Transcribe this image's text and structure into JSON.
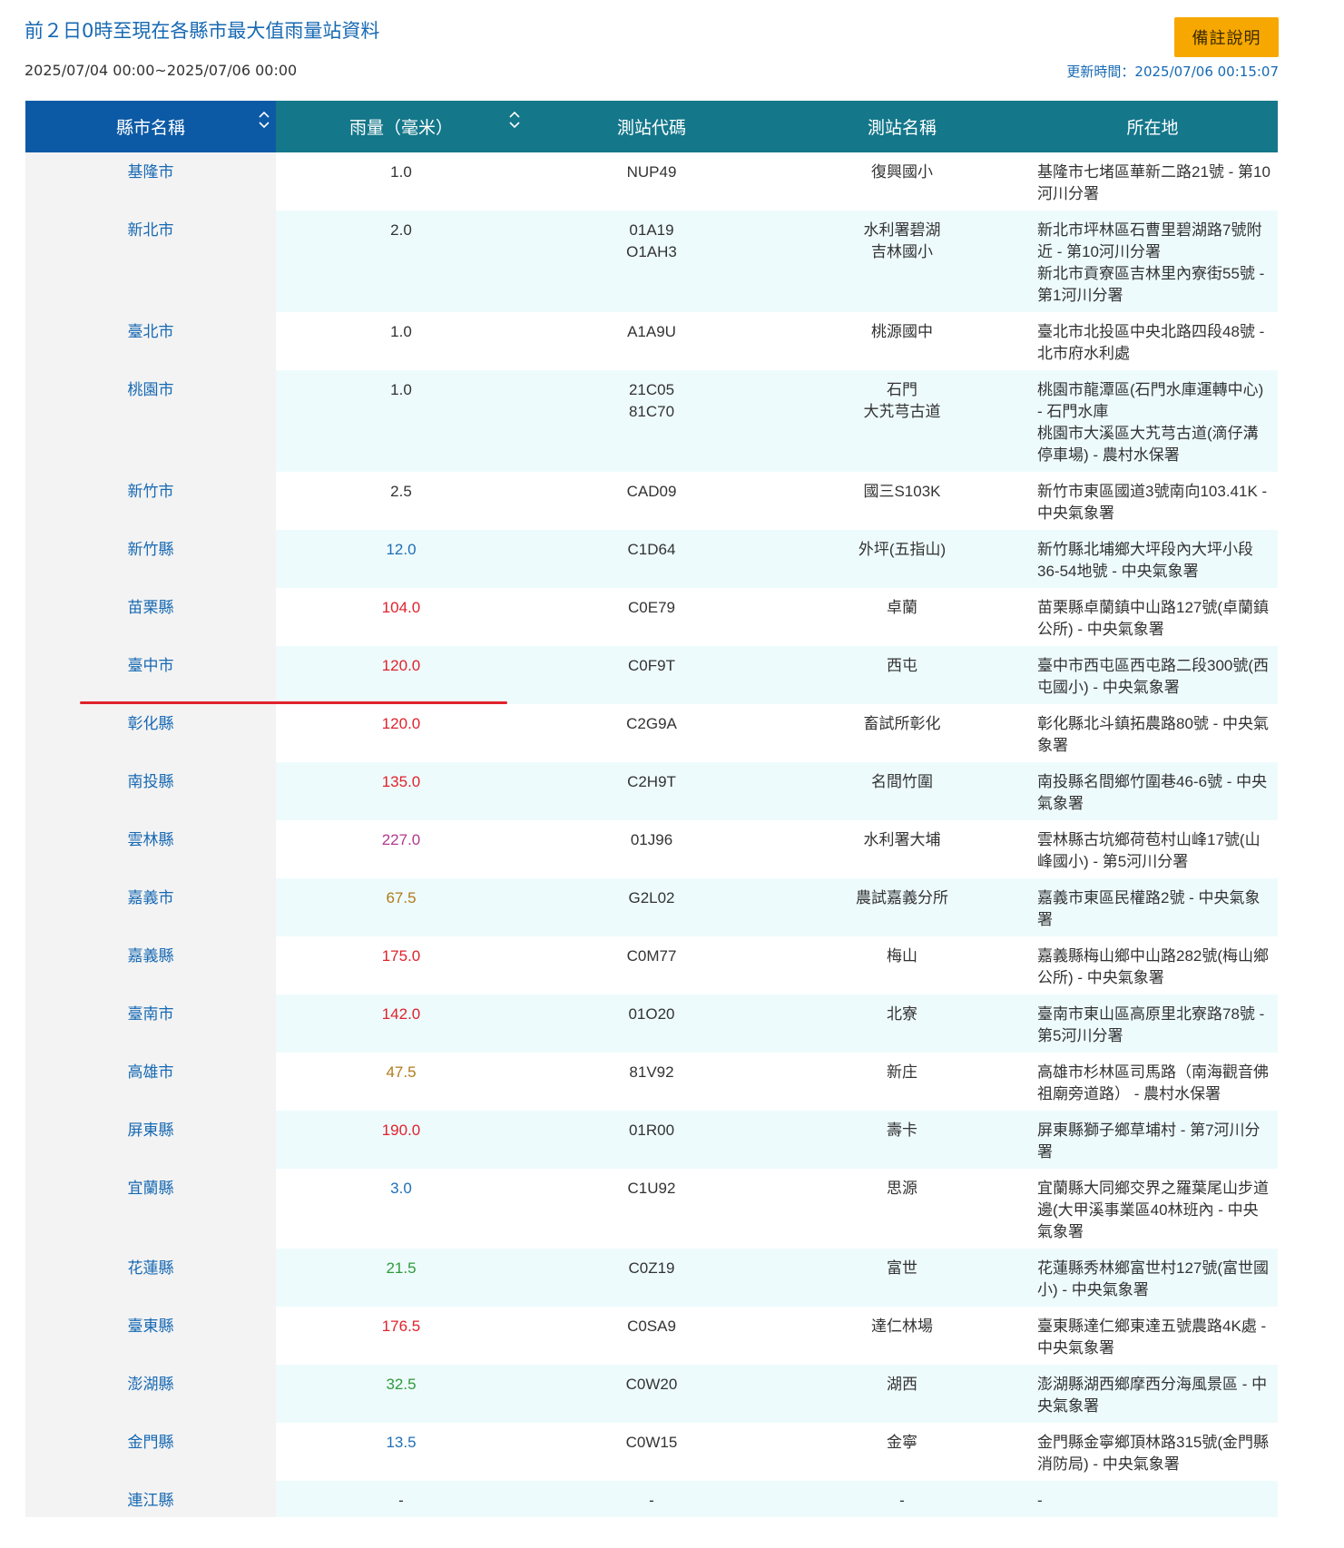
{
  "header": {
    "title": "前２日0時至現在各縣市最大值雨量站資料",
    "date_range": "2025/07/04 00:00~2025/07/06 00:00",
    "notes_button": "備註說明",
    "update_time": "更新時間：2025/07/06 00:15:07"
  },
  "table": {
    "columns": [
      "縣市名稱",
      "雨量（毫米）",
      "測站代碼",
      "測站名稱",
      "所在地"
    ],
    "rows": [
      {
        "county": "基隆市",
        "rain": "1.0",
        "rain_color": "#333333",
        "codes": [
          "NUP49"
        ],
        "names": [
          "復興國小"
        ],
        "locations": [
          "基隆市七堵區華新二路21號 - 第10河川分署"
        ]
      },
      {
        "county": "新北市",
        "rain": "2.0",
        "rain_color": "#333333",
        "codes": [
          "01A19",
          "O1AH3"
        ],
        "names": [
          "水利署碧湖",
          "吉林國小"
        ],
        "locations": [
          "新北市坪林區石曹里碧湖路7號附近 - 第10河川分署",
          "新北市貢寮區吉林里內寮街55號 - 第1河川分署"
        ]
      },
      {
        "county": "臺北市",
        "rain": "1.0",
        "rain_color": "#333333",
        "codes": [
          "A1A9U"
        ],
        "names": [
          "桃源國中"
        ],
        "locations": [
          "臺北市北投區中央北路四段48號 - 北市府水利處"
        ]
      },
      {
        "county": "桃園市",
        "rain": "1.0",
        "rain_color": "#333333",
        "codes": [
          "21C05",
          "81C70"
        ],
        "names": [
          "石門",
          "大艽芎古道"
        ],
        "locations": [
          "桃園市龍潭區(石門水庫運轉中心) - 石門水庫",
          "桃園市大溪區大艽芎古道(滴仔溝停車場) - 農村水保署"
        ]
      },
      {
        "county": "新竹市",
        "rain": "2.5",
        "rain_color": "#333333",
        "codes": [
          "CAD09"
        ],
        "names": [
          "國三S103K"
        ],
        "locations": [
          "新竹市東區國道3號南向103.41K - 中央氣象署"
        ]
      },
      {
        "county": "新竹縣",
        "rain": "12.0",
        "rain_color": "#1f6fb5",
        "codes": [
          "C1D64"
        ],
        "names": [
          "外坪(五指山)"
        ],
        "locations": [
          "新竹縣北埔鄉大坪段內大坪小段36-54地號 - 中央氣象署"
        ]
      },
      {
        "county": "苗栗縣",
        "rain": "104.0",
        "rain_color": "#e0222b",
        "codes": [
          "C0E79"
        ],
        "names": [
          "卓蘭"
        ],
        "locations": [
          "苗栗縣卓蘭鎮中山路127號(卓蘭鎮公所) - 中央氣象署"
        ]
      },
      {
        "county": "臺中市",
        "rain": "120.0",
        "rain_color": "#e0222b",
        "codes": [
          "C0F9T"
        ],
        "names": [
          "西屯"
        ],
        "locations": [
          "臺中市西屯區西屯路二段300號(西屯國小) - 中央氣象署"
        ]
      },
      {
        "county": "彰化縣",
        "rain": "120.0",
        "rain_color": "#e0222b",
        "codes": [
          "C2G9A"
        ],
        "names": [
          "畜試所彰化"
        ],
        "locations": [
          "彰化縣北斗鎮拓農路80號 - 中央氣象署"
        ]
      },
      {
        "county": "南投縣",
        "rain": "135.0",
        "rain_color": "#e0222b",
        "codes": [
          "C2H9T"
        ],
        "names": [
          "名間竹圍"
        ],
        "locations": [
          "南投縣名間鄉竹圍巷46-6號 - 中央氣象署"
        ]
      },
      {
        "county": "雲林縣",
        "rain": "227.0",
        "rain_color": "#b03a8f",
        "codes": [
          "01J96"
        ],
        "names": [
          "水利署大埔"
        ],
        "locations": [
          "雲林縣古坑鄉荷苞村山峰17號(山峰國小) - 第5河川分署"
        ]
      },
      {
        "county": "嘉義市",
        "rain": "67.5",
        "rain_color": "#b07a1a",
        "codes": [
          "G2L02"
        ],
        "names": [
          "農試嘉義分所"
        ],
        "locations": [
          "嘉義市東區民權路2號 - 中央氣象署"
        ]
      },
      {
        "county": "嘉義縣",
        "rain": "175.0",
        "rain_color": "#e0222b",
        "codes": [
          "C0M77"
        ],
        "names": [
          "梅山"
        ],
        "locations": [
          "嘉義縣梅山鄉中山路282號(梅山鄉公所) - 中央氣象署"
        ]
      },
      {
        "county": "臺南市",
        "rain": "142.0",
        "rain_color": "#e0222b",
        "codes": [
          "01O20"
        ],
        "names": [
          "北寮"
        ],
        "locations": [
          "臺南市東山區高原里北寮路78號 - 第5河川分署"
        ]
      },
      {
        "county": "高雄市",
        "rain": "47.5",
        "rain_color": "#b07a1a",
        "codes": [
          "81V92"
        ],
        "names": [
          "新庄"
        ],
        "locations": [
          "高雄市杉林區司馬路（南海觀音佛祖廟旁道路） - 農村水保署"
        ]
      },
      {
        "county": "屏東縣",
        "rain": "190.0",
        "rain_color": "#e0222b",
        "codes": [
          "01R00"
        ],
        "names": [
          "壽卡"
        ],
        "locations": [
          "屏東縣獅子鄉草埔村 - 第7河川分署"
        ]
      },
      {
        "county": "宜蘭縣",
        "rain": "3.0",
        "rain_color": "#1f6fb5",
        "codes": [
          "C1U92"
        ],
        "names": [
          "思源"
        ],
        "locations": [
          "宜蘭縣大同鄉交界之羅葉尾山步道邊(大甲溪事業區40林班內 - 中央氣象署"
        ]
      },
      {
        "county": "花蓮縣",
        "rain": "21.5",
        "rain_color": "#2e9a3a",
        "codes": [
          "C0Z19"
        ],
        "names": [
          "富世"
        ],
        "locations": [
          "花蓮縣秀林鄉富世村127號(富世國小) - 中央氣象署"
        ]
      },
      {
        "county": "臺東縣",
        "rain": "176.5",
        "rain_color": "#e0222b",
        "codes": [
          "C0SA9"
        ],
        "names": [
          "達仁林場"
        ],
        "locations": [
          "臺東縣達仁鄉東達五號農路4K處 - 中央氣象署"
        ]
      },
      {
        "county": "澎湖縣",
        "rain": "32.5",
        "rain_color": "#2e9a3a",
        "codes": [
          "C0W20"
        ],
        "names": [
          "湖西"
        ],
        "locations": [
          "澎湖縣湖西鄉摩西分海風景區 - 中央氣象署"
        ]
      },
      {
        "county": "金門縣",
        "rain": "13.5",
        "rain_color": "#1f6fb5",
        "codes": [
          "C0W15"
        ],
        "names": [
          "金寧"
        ],
        "locations": [
          "金門縣金寧鄉頂林路315號(金門縣消防局) - 中央氣象署"
        ]
      },
      {
        "county": "連江縣",
        "rain": "-",
        "rain_color": "#333333",
        "codes": [
          "-"
        ],
        "names": [
          "-"
        ],
        "locations": [
          "-"
        ]
      }
    ]
  },
  "icons": {
    "sort": "sort-icon"
  }
}
